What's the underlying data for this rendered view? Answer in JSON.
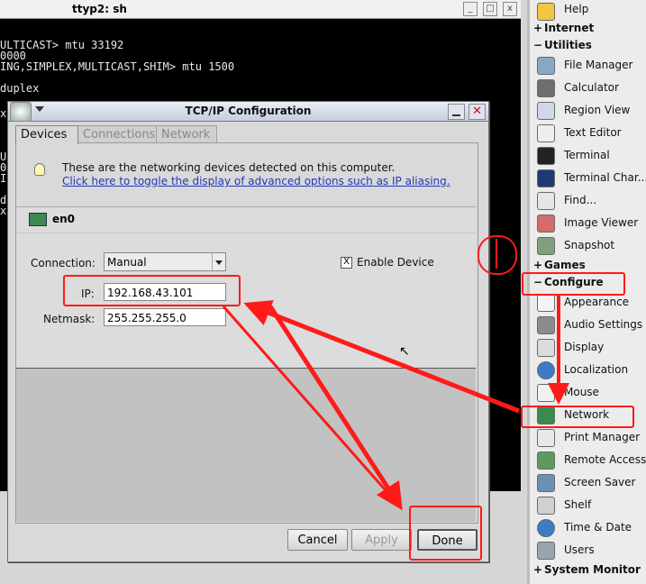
{
  "terminal": {
    "title": "ttyp2: sh",
    "lines": [
      "ULTICAST> mtu 33192",
      "0000",
      "ING,SIMPLEX,MULTICAST,SHIM> mtu 1500",
      "",
      "duplex"
    ],
    "side_chars": "x\n\n\n\nU\n0\nI\n\nd\nx"
  },
  "dialog": {
    "title": "TCP/IP Configuration",
    "tabs": [
      "Devices",
      "Connections",
      "Network"
    ],
    "info_text": "These are the networking devices detected on this computer.",
    "info_link": "Click here to toggle the display of advanced options such as IP aliasing.",
    "device_name": "en0",
    "connection_label": "Connection:",
    "connection_value": "Manual",
    "enable_device_label": "Enable Device",
    "enable_device_checked": "X",
    "ip_label": "IP:",
    "ip_value": "192.168.43.101",
    "netmask_label": "Netmask:",
    "netmask_value": "255.255.255.0",
    "buttons": {
      "cancel": "Cancel",
      "apply": "Apply",
      "done": "Done"
    }
  },
  "sidebar": {
    "top_item": "Help",
    "sections": {
      "internet": "Internet",
      "utilities": "Utilities",
      "games": "Games",
      "configure": "Configure",
      "system_monitor": "System Monitor"
    },
    "utilities": [
      "File Manager",
      "Calculator",
      "Region View",
      "Text Editor",
      "Terminal",
      "Terminal Char...",
      "Find...",
      "Image Viewer",
      "Snapshot"
    ],
    "configure": [
      "Appearance",
      "Audio Settings",
      "Display",
      "Localization",
      "Mouse",
      "Network",
      "Print Manager",
      "Remote Access",
      "Screen Saver",
      "Shelf",
      "Time & Date",
      "Users"
    ]
  },
  "colors": {
    "annotation_red": "#ff1a1a",
    "link_blue": "#2238b8"
  }
}
